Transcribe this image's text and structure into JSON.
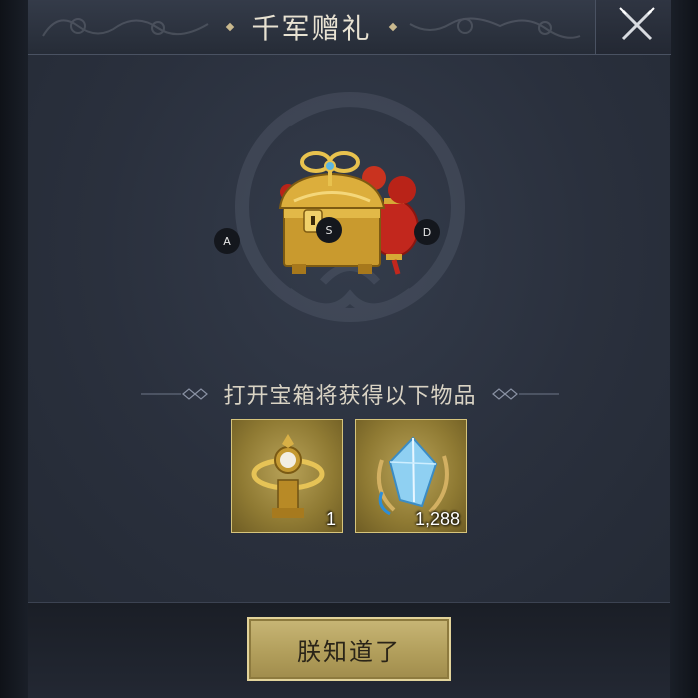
{
  "dialog": {
    "title": "千军赠礼",
    "close_icon": "close-icon"
  },
  "chest": {
    "icon": "treasure-chest-icon",
    "key_hints": {
      "left": "A",
      "center": "S",
      "right": "D"
    }
  },
  "rewards": {
    "subtitle": "打开宝箱将获得以下物品",
    "items": [
      {
        "icon": "golden-pearl-ring-icon",
        "count": "1"
      },
      {
        "icon": "blue-crystal-icon",
        "count": "1,288"
      }
    ]
  },
  "footer": {
    "confirm_label": "朕知道了"
  },
  "colors": {
    "gold_accent": "#c8b676",
    "panel_bg": "#2a303d",
    "title_text": "#e8e2d2"
  }
}
